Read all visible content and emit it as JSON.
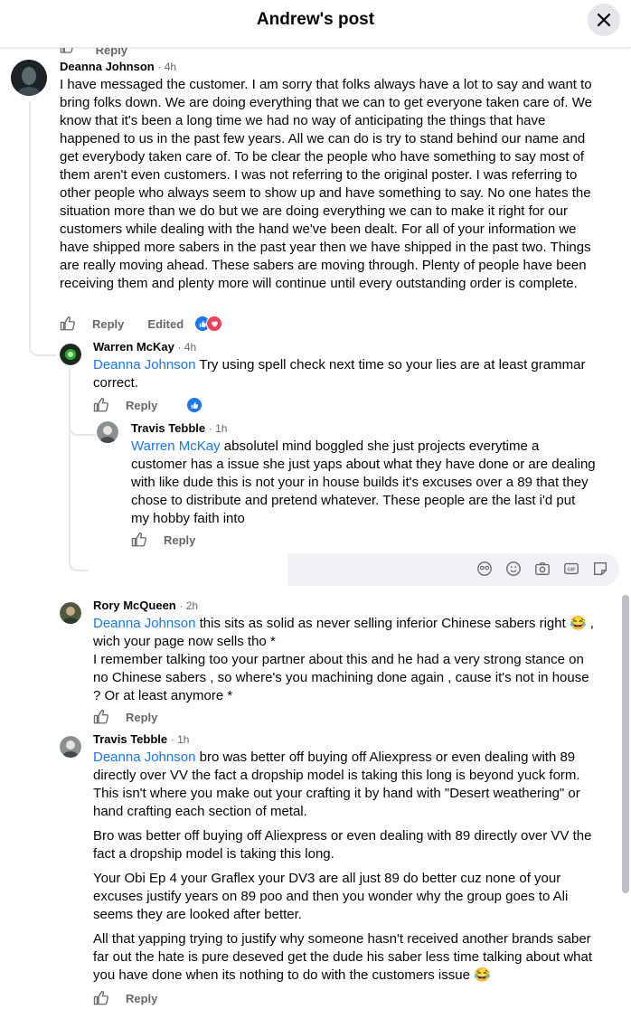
{
  "header": {
    "title": "Andrew's post"
  },
  "top_partial": {
    "reply_label": "Reply"
  },
  "comments": [
    {
      "author": "Deanna Johnson",
      "time": "· 4h",
      "text": "I have messaged the customer. I am sorry that folks always have a lot to say and want to bring folks down. We are doing everything that we can to get everyone taken care of. We know that it's been a long time we had no way of anticipating the things that have happened to us in the past few years. All we can do is try to stand behind our name and get everybody taken care of. To be clear the people who have something to say most of them aren't even customers. I was not referring to the original poster. I was referring to other people who always seem to show up and have something to say. No one hates the situation more than we do but we are doing everything we can to make it right for our customers while dealing with the hand we've been dealt. For all of your information we have shipped more sabers in the past year then we have shipped in the past two. Things are really moving ahead. These sabers are moving through. Plenty of people have been receiving them and plenty more will continue until every outstanding order is complete.",
      "reply_label": "Reply",
      "edited_label": "Edited"
    },
    {
      "author": "Warren McKay",
      "time": "· 4h",
      "mention": "Deanna Johnson",
      "text": " Try using spell check next time so your lies are at least grammar correct.",
      "reply_label": "Reply"
    },
    {
      "author": "Travis Tebble",
      "time": "· 1h",
      "mention": "Warren McKay",
      "text": " absolutel mind boggled she just projects everytime a customer has a issue she just yaps about what they have done or are dealing with like dude this is not your in house builds it's excuses over a 89 that they chose to distribute and pretend whatever. These people are the last i'd put my hobby faith into",
      "reply_label": "Reply"
    },
    {
      "author": "Rory McQueen",
      "time": "· 2h",
      "mention": "Deanna Johnson",
      "text1": " this sits as solid as never selling inferior Chinese sabers right 😂 , wich your page now sells tho *",
      "text2": "I remember talking too your partner about this and he had a very strong stance on no Chinese sabers , so where's you machining done again , cause it's not in house ? Or at least anymore *",
      "reply_label": "Reply"
    },
    {
      "author": "Travis Tebble",
      "time": "· 1h",
      "mention": "Deanna Johnson",
      "p1": " bro was better off buying off Aliexpress or even dealing with 89 directly over VV the fact a dropship model is taking this long is beyond yuck form. This isn't where you make out your crafting it by hand with \"Desert weathering\" or hand crafting each section of metal.",
      "p2": "Bro was better off buying off Aliexpress or even dealing with 89 directly over VV the fact a dropship model is taking this long.",
      "p3": "Your Obi Ep 4 your Graflex your DV3 are all just 89 do better cuz none of your excuses justify years on 89 poo and then you wonder why the group goes to Ali seems they are looked after better.",
      "p4": "All that yapping trying to justify why someone hasn't received another brands saber far out the hate is pure deseved get the dude his saber less time talking about what you have done when its nothing to do with the customers issue 😂",
      "reply_label": "Reply"
    }
  ],
  "composer": {
    "icons": [
      "sticker-face-icon",
      "emoji-icon",
      "camera-icon",
      "gif-icon",
      "sticker-icon"
    ]
  },
  "colors": {
    "link": "#1877f2",
    "secondary": "#65676b",
    "like_blue": "#1877f2",
    "love_red": "#f33e58"
  }
}
